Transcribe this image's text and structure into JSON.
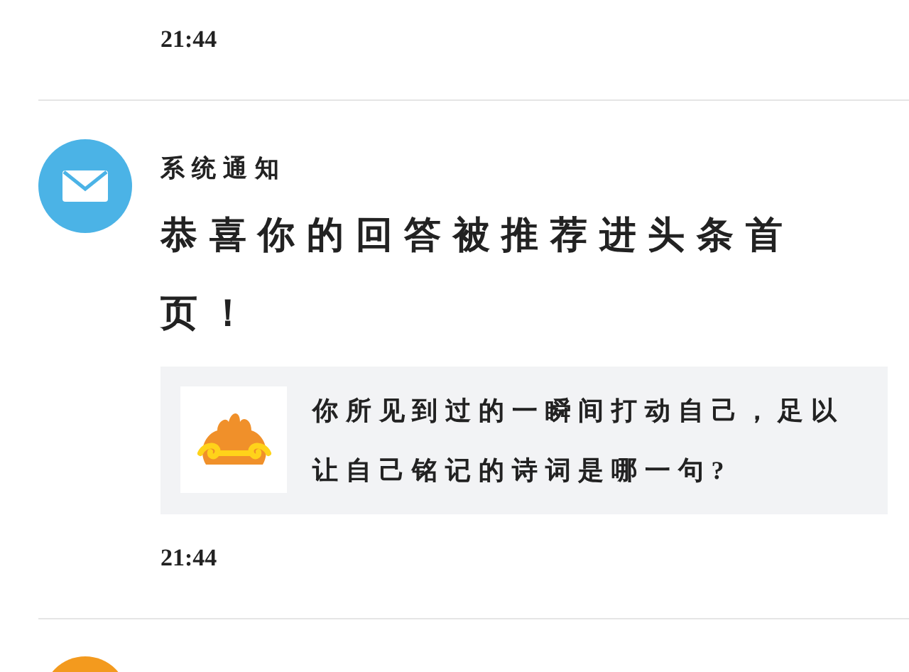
{
  "previous_item": {
    "time": "21:44"
  },
  "notification": {
    "sender": "系统通知",
    "title": "恭喜你的回答被推荐进头条首页！",
    "question": {
      "text": "你所见到过的一瞬间打动自己，足以让自己铭记的诗词是哪一句?"
    },
    "time": "21:44"
  }
}
